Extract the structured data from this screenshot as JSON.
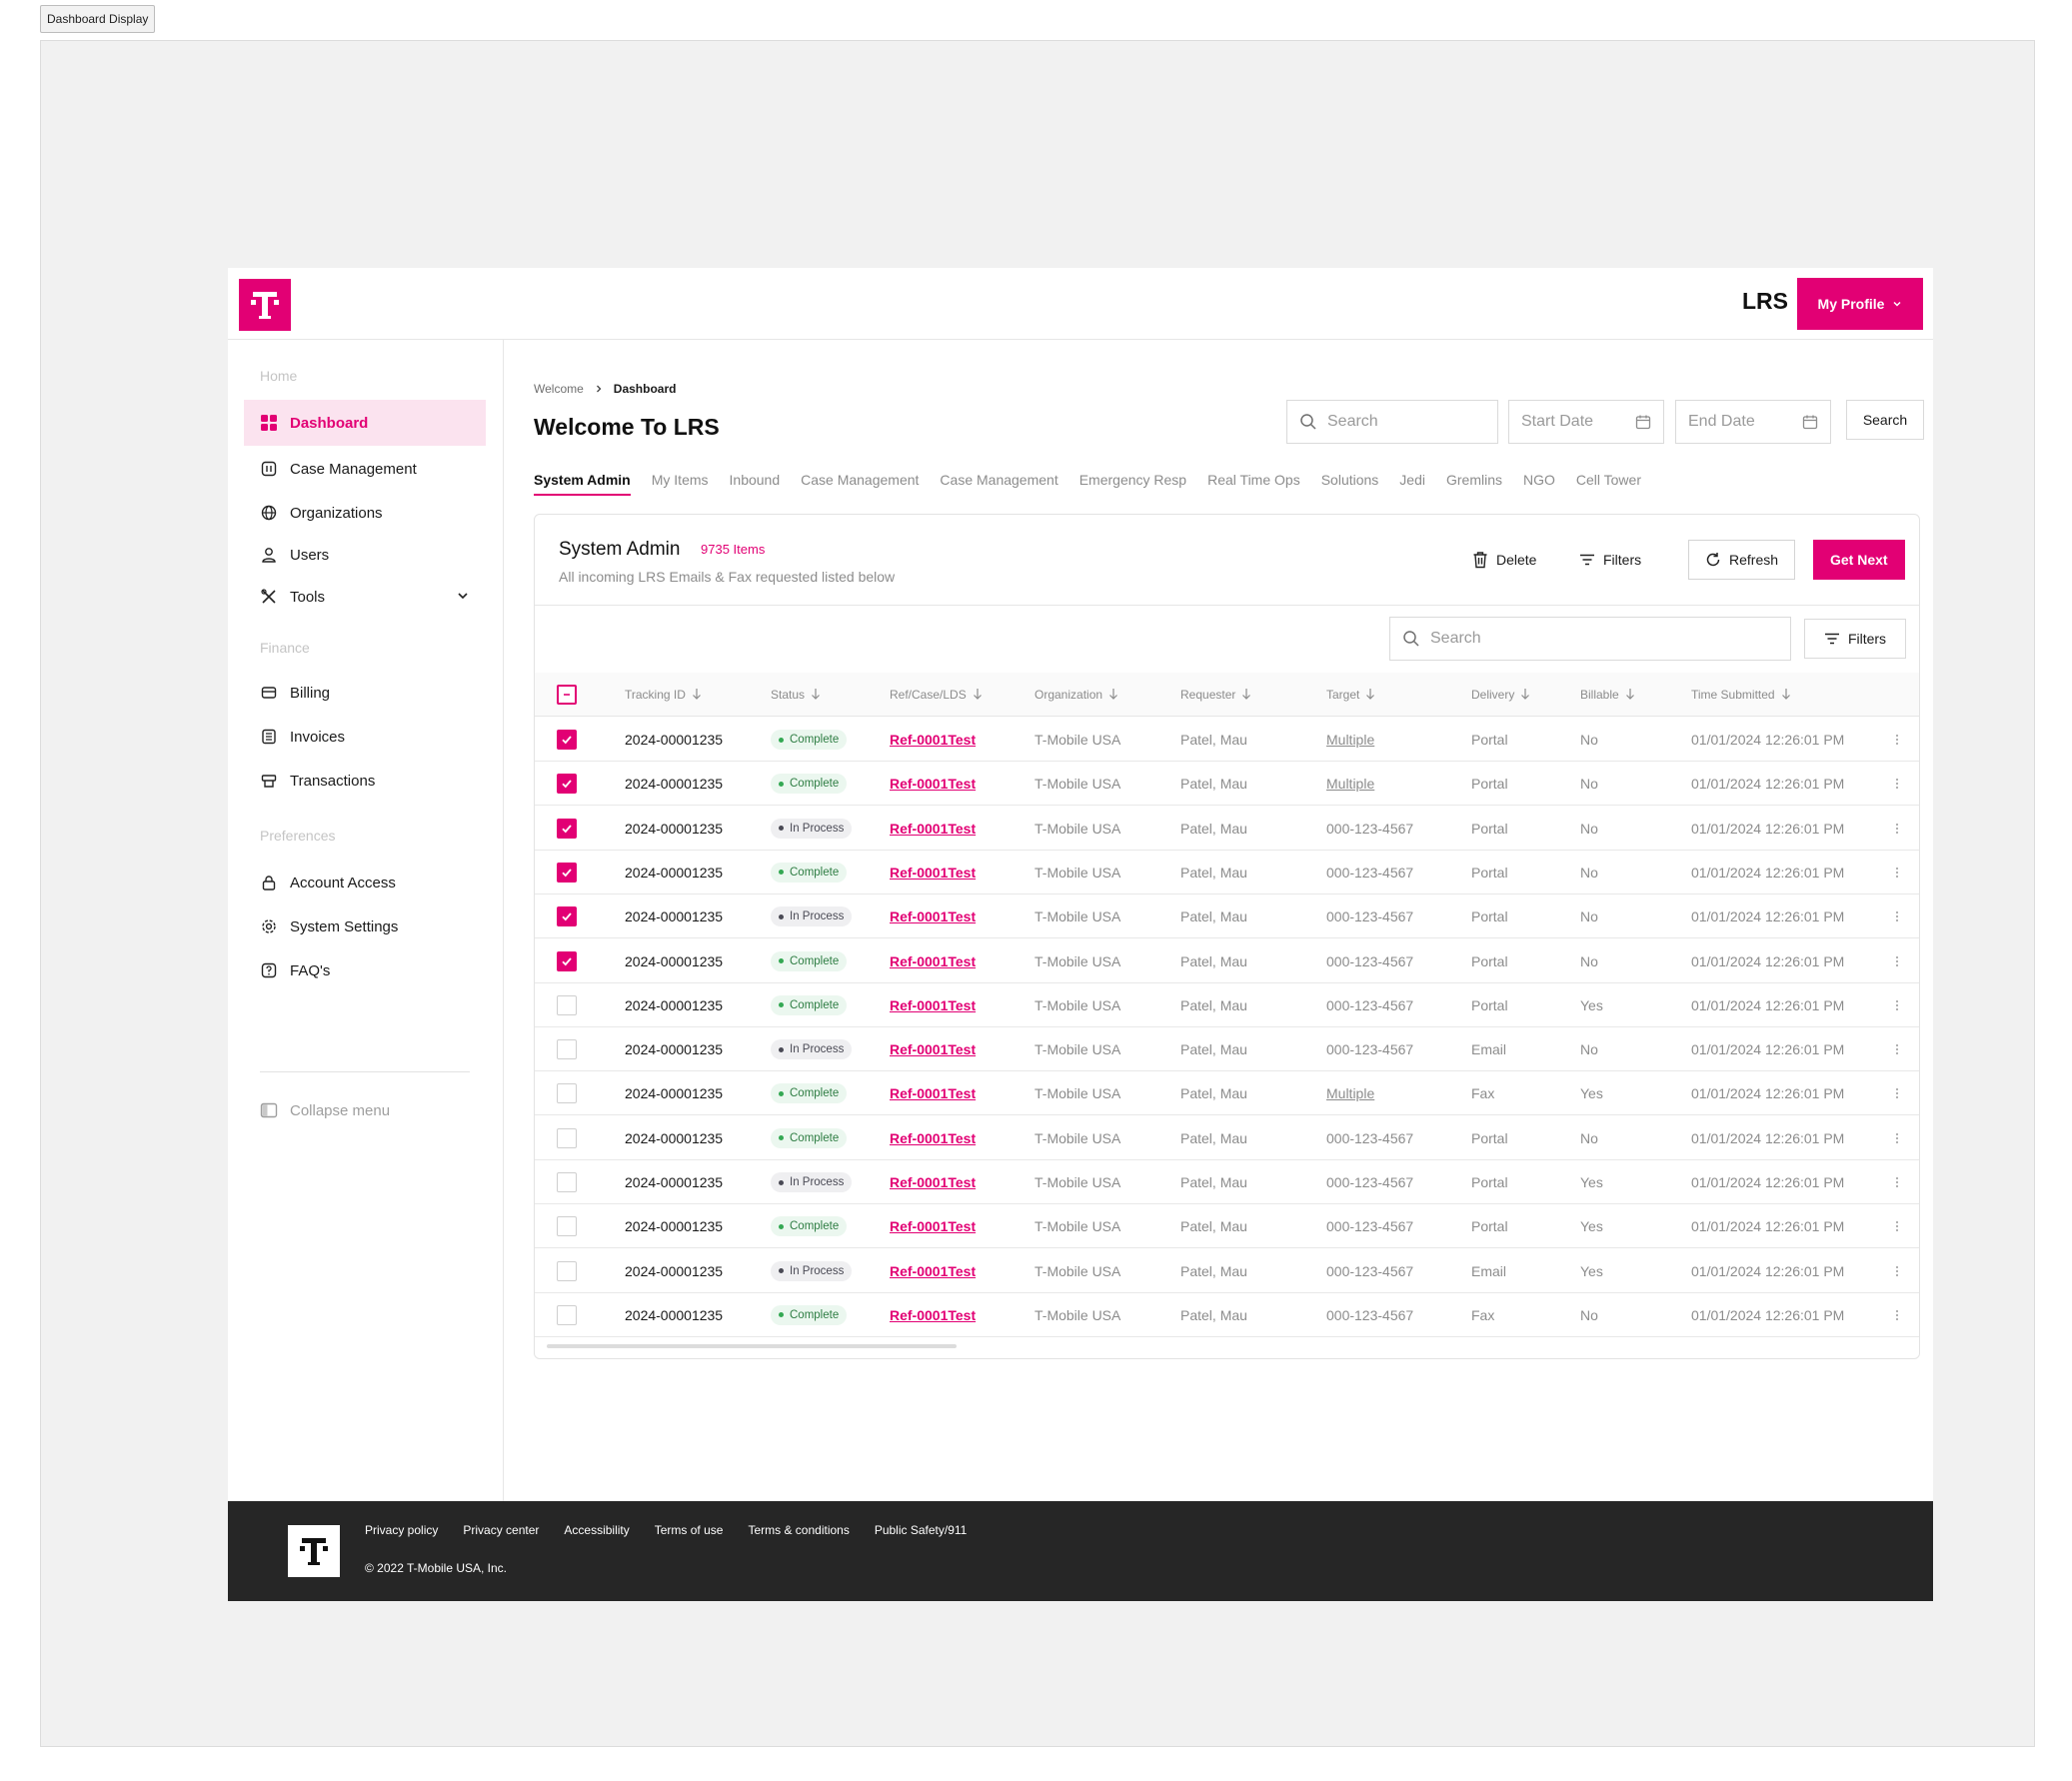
{
  "frame_label": "Dashboard Display",
  "header": {
    "app_name": "LRS",
    "profile_label": "My Profile"
  },
  "sidebar": {
    "sections": [
      {
        "title": "Home",
        "items": [
          {
            "key": "dashboard",
            "label": "Dashboard",
            "icon": "grid-icon",
            "active": true
          },
          {
            "key": "case",
            "label": "Case Management",
            "icon": "case-icon"
          },
          {
            "key": "orgs",
            "label": "Organizations",
            "icon": "globe-icon"
          },
          {
            "key": "users",
            "label": "Users",
            "icon": "user-icon"
          },
          {
            "key": "tools",
            "label": "Tools",
            "icon": "tools-icon",
            "expandable": true
          }
        ]
      },
      {
        "title": "Finance",
        "items": [
          {
            "key": "billing",
            "label": "Billing",
            "icon": "card-icon"
          },
          {
            "key": "invoices",
            "label": "Invoices",
            "icon": "invoice-icon"
          },
          {
            "key": "transactions",
            "label": "Transactions",
            "icon": "transactions-icon"
          }
        ]
      },
      {
        "title": "Preferences",
        "items": [
          {
            "key": "access",
            "label": "Account Access",
            "icon": "lock-icon"
          },
          {
            "key": "settings",
            "label": "System Settings",
            "icon": "gear-icon"
          },
          {
            "key": "faq",
            "label": "FAQ's",
            "icon": "faq-icon"
          }
        ]
      }
    ],
    "collapse_label": "Collapse menu"
  },
  "breadcrumb": {
    "parent": "Welcome",
    "current": "Dashboard"
  },
  "page_title": "Welcome To LRS",
  "top_search": {
    "placeholder": "Search",
    "start_placeholder": "Start Date",
    "end_placeholder": "End Date",
    "button": "Search"
  },
  "tabs": [
    "System Admin",
    "My Items",
    "Inbound",
    "Case Management",
    "Case Management",
    "Emergency Resp",
    "Real Time Ops",
    "Solutions",
    "Jedi",
    "Gremlins",
    "NGO",
    "Cell Tower"
  ],
  "active_tab": 0,
  "card": {
    "title": "System Admin",
    "count": "9735 Items",
    "subtitle": "All incoming LRS Emails & Fax requested listed below",
    "actions": {
      "delete": "Delete",
      "filters": "Filters",
      "refresh": "Refresh",
      "get_next": "Get Next"
    },
    "search_placeholder": "Search",
    "filter_label": "Filters"
  },
  "table": {
    "columns": [
      "Tracking ID",
      "Status",
      "Ref/Case/LDS",
      "Organization",
      "Requester",
      "Target",
      "Delivery",
      "Billable",
      "Time Submitted"
    ],
    "rows": [
      {
        "checked": true,
        "id": "2024-00001235",
        "status": "Complete",
        "ref": "Ref-0001Test",
        "org": "T-Mobile USA",
        "req": "Patel, Mau",
        "target": "Multiple",
        "delivery": "Portal",
        "billable": "No",
        "time": "01/01/2024 12:26:01 PM"
      },
      {
        "checked": true,
        "id": "2024-00001235",
        "status": "Complete",
        "ref": "Ref-0001Test",
        "org": "T-Mobile USA",
        "req": "Patel, Mau",
        "target": "Multiple",
        "delivery": "Portal",
        "billable": "No",
        "time": "01/01/2024 12:26:01 PM"
      },
      {
        "checked": true,
        "id": "2024-00001235",
        "status": "In Process",
        "ref": "Ref-0001Test",
        "org": "T-Mobile USA",
        "req": "Patel, Mau",
        "target": "000-123-4567",
        "delivery": "Portal",
        "billable": "No",
        "time": "01/01/2024 12:26:01 PM"
      },
      {
        "checked": true,
        "id": "2024-00001235",
        "status": "Complete",
        "ref": "Ref-0001Test",
        "org": "T-Mobile USA",
        "req": "Patel, Mau",
        "target": "000-123-4567",
        "delivery": "Portal",
        "billable": "No",
        "time": "01/01/2024 12:26:01 PM"
      },
      {
        "checked": true,
        "id": "2024-00001235",
        "status": "In Process",
        "ref": "Ref-0001Test",
        "org": "T-Mobile USA",
        "req": "Patel, Mau",
        "target": "000-123-4567",
        "delivery": "Portal",
        "billable": "No",
        "time": "01/01/2024 12:26:01 PM"
      },
      {
        "checked": true,
        "id": "2024-00001235",
        "status": "Complete",
        "ref": "Ref-0001Test",
        "org": "T-Mobile USA",
        "req": "Patel, Mau",
        "target": "000-123-4567",
        "delivery": "Portal",
        "billable": "No",
        "time": "01/01/2024 12:26:01 PM"
      },
      {
        "checked": false,
        "id": "2024-00001235",
        "status": "Complete",
        "ref": "Ref-0001Test",
        "org": "T-Mobile USA",
        "req": "Patel, Mau",
        "target": "000-123-4567",
        "delivery": "Portal",
        "billable": "Yes",
        "time": "01/01/2024 12:26:01 PM"
      },
      {
        "checked": false,
        "id": "2024-00001235",
        "status": "In Process",
        "ref": "Ref-0001Test",
        "org": "T-Mobile USA",
        "req": "Patel, Mau",
        "target": "000-123-4567",
        "delivery": "Email",
        "billable": "No",
        "time": "01/01/2024 12:26:01 PM"
      },
      {
        "checked": false,
        "id": "2024-00001235",
        "status": "Complete",
        "ref": "Ref-0001Test",
        "org": "T-Mobile USA",
        "req": "Patel, Mau",
        "target": "Multiple",
        "delivery": "Fax",
        "billable": "Yes",
        "time": "01/01/2024 12:26:01 PM"
      },
      {
        "checked": false,
        "id": "2024-00001235",
        "status": "Complete",
        "ref": "Ref-0001Test",
        "org": "T-Mobile USA",
        "req": "Patel, Mau",
        "target": "000-123-4567",
        "delivery": "Portal",
        "billable": "No",
        "time": "01/01/2024 12:26:01 PM"
      },
      {
        "checked": false,
        "id": "2024-00001235",
        "status": "In Process",
        "ref": "Ref-0001Test",
        "org": "T-Mobile USA",
        "req": "Patel, Mau",
        "target": "000-123-4567",
        "delivery": "Portal",
        "billable": "Yes",
        "time": "01/01/2024 12:26:01 PM"
      },
      {
        "checked": false,
        "id": "2024-00001235",
        "status": "Complete",
        "ref": "Ref-0001Test",
        "org": "T-Mobile USA",
        "req": "Patel, Mau",
        "target": "000-123-4567",
        "delivery": "Portal",
        "billable": "Yes",
        "time": "01/01/2024 12:26:01 PM"
      },
      {
        "checked": false,
        "id": "2024-00001235",
        "status": "In Process",
        "ref": "Ref-0001Test",
        "org": "T-Mobile USA",
        "req": "Patel, Mau",
        "target": "000-123-4567",
        "delivery": "Email",
        "billable": "Yes",
        "time": "01/01/2024 12:26:01 PM"
      },
      {
        "checked": false,
        "id": "2024-00001235",
        "status": "Complete",
        "ref": "Ref-0001Test",
        "org": "T-Mobile USA",
        "req": "Patel, Mau",
        "target": "000-123-4567",
        "delivery": "Fax",
        "billable": "No",
        "time": "01/01/2024 12:26:01 PM"
      }
    ]
  },
  "footer": {
    "links": [
      "Privacy policy",
      "Privacy center",
      "Accessibility",
      "Terms of use",
      "Terms & conditions",
      "Public Safety/911"
    ],
    "copyright": "© 2022 T-Mobile USA, Inc."
  },
  "colors": {
    "brand": "#e20074",
    "complete_bg": "#ebf7ef",
    "complete_fg": "#2e7d43",
    "process_bg": "#efeff1",
    "process_fg": "#4a4a55"
  }
}
